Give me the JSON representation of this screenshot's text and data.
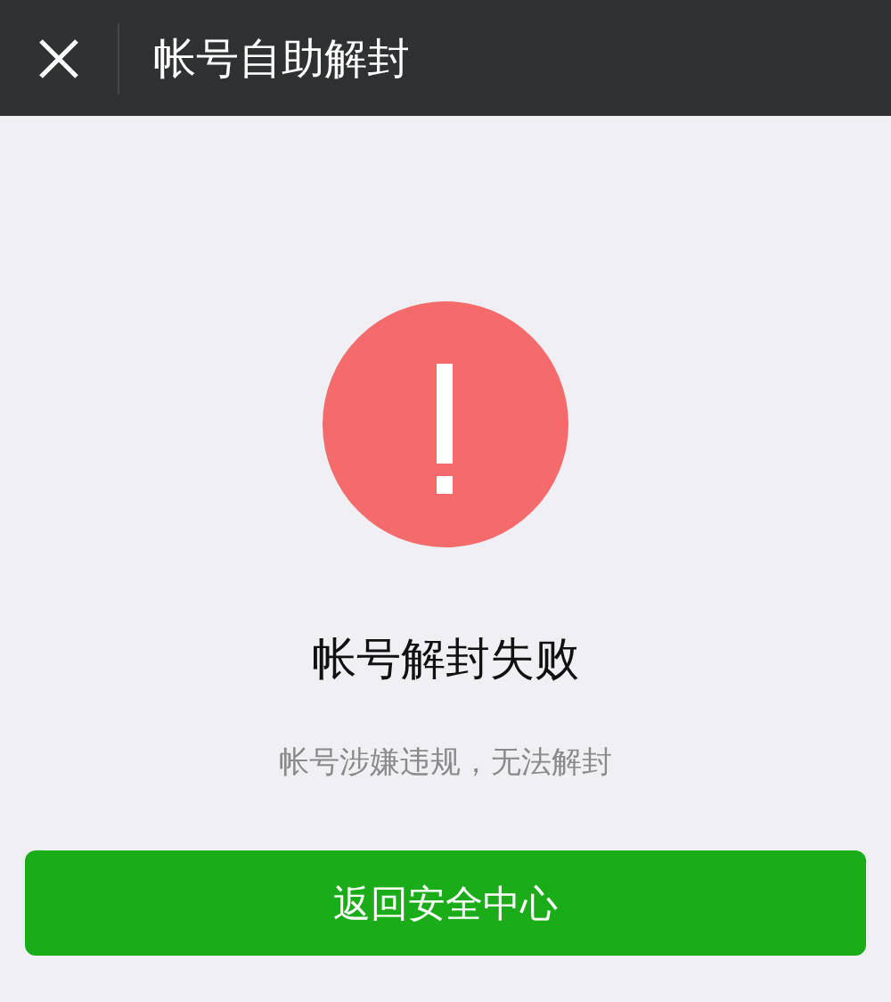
{
  "header": {
    "title": "帐号自助解封"
  },
  "result": {
    "kind": "error",
    "title": "帐号解封失败",
    "message": "帐号涉嫌违规，无法解封"
  },
  "buttons": [
    {
      "label": "返回安全中心",
      "kind": "primary"
    }
  ]
}
